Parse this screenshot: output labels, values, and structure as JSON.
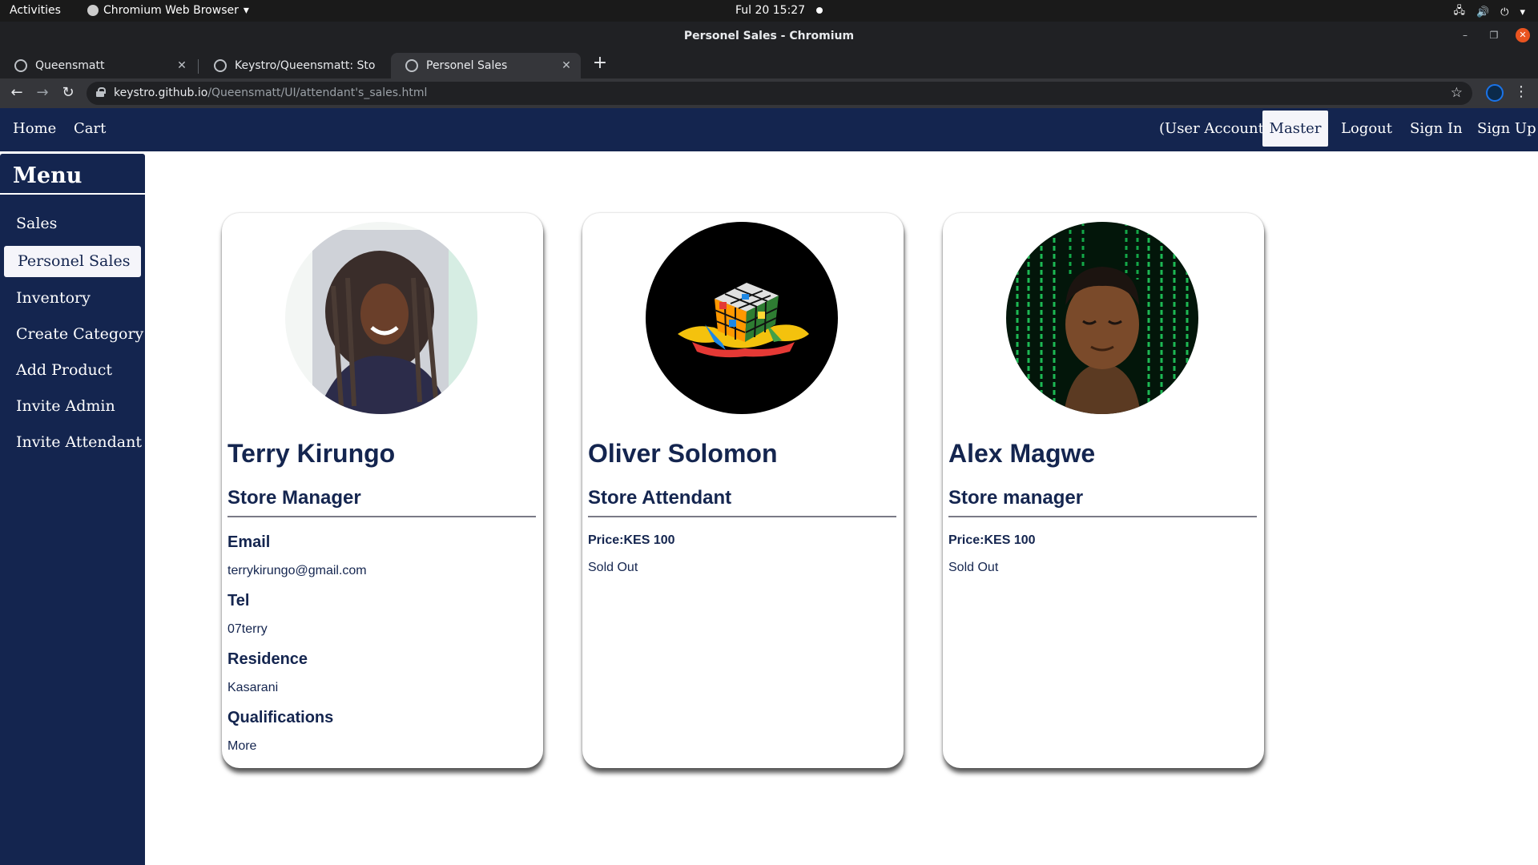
{
  "os_bar": {
    "activities": "Activities",
    "app_name": "Chromium Web Browser",
    "clock": "Ful 20  15:27"
  },
  "browser": {
    "window_title": "Personel Sales - Chromium",
    "tabs": [
      {
        "label": "Queensmatt",
        "active": false
      },
      {
        "label": "Keystro/Queensmatt: Sto",
        "active": false
      },
      {
        "label": "Personel Sales",
        "active": true
      }
    ],
    "url_host": "keystro.github.io",
    "url_path": "/Queensmatt/UI/attendant's_sales.html"
  },
  "site_nav": {
    "left": [
      "Home",
      "Cart"
    ],
    "user_account": "(User Account)",
    "master": "Master",
    "logout": "Logout",
    "sign_in": "Sign In",
    "sign_up": "Sign Up"
  },
  "sidebar": {
    "title": "Menu",
    "items": [
      "Sales",
      "Personel Sales",
      "Inventory",
      "Create Category",
      "Add Product",
      "Invite Admin",
      "Invite Attendant"
    ],
    "active_item": "Personel Sales"
  },
  "cards": [
    {
      "name": "Terry Kirungo",
      "role": "Store Manager",
      "email_label": "Email",
      "email": "terrykirungo@gmail.com",
      "tel_label": "Tel",
      "tel": "07terry",
      "residence_label": "Residence",
      "residence": "Kasarani",
      "qualifications_label": "Qualifications",
      "qualifications": "More"
    },
    {
      "name": "Oliver Solomon",
      "role": "Store Attendant",
      "price": "Price:KES 100",
      "status": "Sold Out"
    },
    {
      "name": "Alex Magwe",
      "role": "Store manager",
      "price": "Price:KES 100",
      "status": "Sold Out"
    }
  ],
  "colors": {
    "navy": "#14254f",
    "active_bg": "#f5f5fa",
    "close_button": "#e95420"
  }
}
